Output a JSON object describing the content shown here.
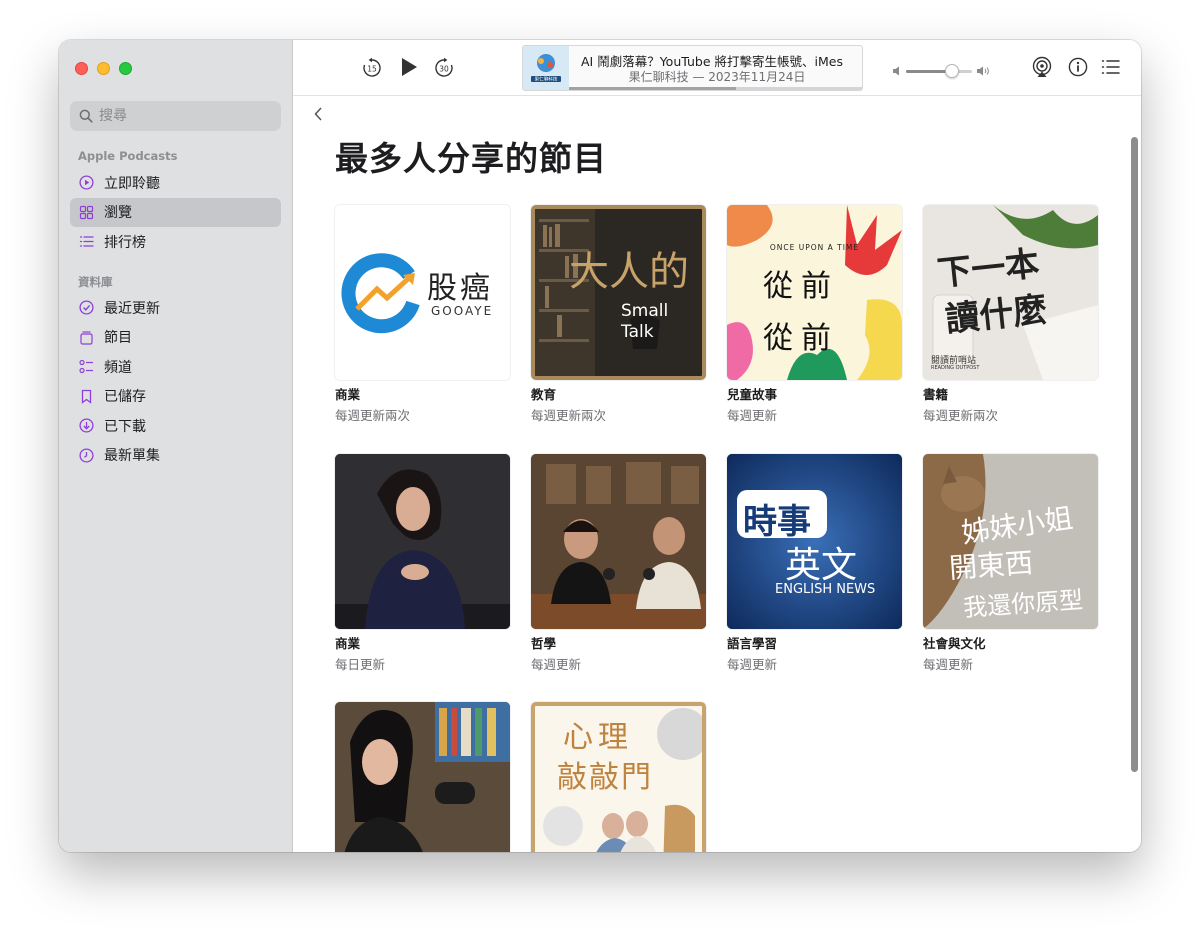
{
  "sidebar": {
    "search_placeholder": "搜尋",
    "section_podcasts": "Apple Podcasts",
    "section_library": "資料庫",
    "podcast_items": [
      {
        "label": "立即聆聽",
        "icon": "play-circle-icon"
      },
      {
        "label": "瀏覽",
        "icon": "grid-icon"
      },
      {
        "label": "排行榜",
        "icon": "list-icon"
      }
    ],
    "library_items": [
      {
        "label": "最近更新",
        "icon": "checkmark-circle-icon"
      },
      {
        "label": "節目",
        "icon": "shows-icon"
      },
      {
        "label": "頻道",
        "icon": "channels-icon"
      },
      {
        "label": "已儲存",
        "icon": "bookmark-icon"
      },
      {
        "label": "已下載",
        "icon": "download-icon"
      },
      {
        "label": "最新單集",
        "icon": "clock-icon"
      }
    ],
    "active_item": "瀏覽"
  },
  "toolbar": {
    "skip_back": "15",
    "skip_forward": "30",
    "now_playing": {
      "title": "AI 鬧劇落幕？YouTube 將打擊寄生帳號、iMes",
      "subtitle": "果仁聊科技 — 2023年11月24日",
      "art_label": "果仁聊科技",
      "progress": 0.57
    },
    "volume": 0.7
  },
  "page": {
    "title": "最多人分享的節目"
  },
  "shows": [
    {
      "category": "商業",
      "frequency": "每週更新兩次",
      "cover_text": [
        "股癌",
        "GOOAYE"
      ]
    },
    {
      "category": "教育",
      "frequency": "每週更新兩次",
      "cover_text": [
        "大人的",
        "Small",
        "Talk"
      ]
    },
    {
      "category": "兒童故事",
      "frequency": "每週更新",
      "cover_text": [
        "ONCE UPON A TIME",
        "從前",
        "從前"
      ]
    },
    {
      "category": "書籍",
      "frequency": "每週更新兩次",
      "cover_text": [
        "下一本",
        "讀什麼",
        "閱讀前哨站",
        "READING OUTPOST"
      ]
    },
    {
      "category": "商業",
      "frequency": "每日更新",
      "cover_text": []
    },
    {
      "category": "哲學",
      "frequency": "每週更新",
      "cover_text": []
    },
    {
      "category": "語言學習",
      "frequency": "每週更新",
      "cover_text": [
        "時事",
        "英文",
        "ENGLISH NEWS"
      ]
    },
    {
      "category": "社會與文化",
      "frequency": "每週更新",
      "cover_text": [
        "姊妹小姐",
        "開東西",
        "我還你原型"
      ]
    },
    {
      "category": "",
      "frequency": "",
      "cover_text": []
    },
    {
      "category": "",
      "frequency": "",
      "cover_text": [
        "心理",
        "敲敲門"
      ]
    }
  ]
}
